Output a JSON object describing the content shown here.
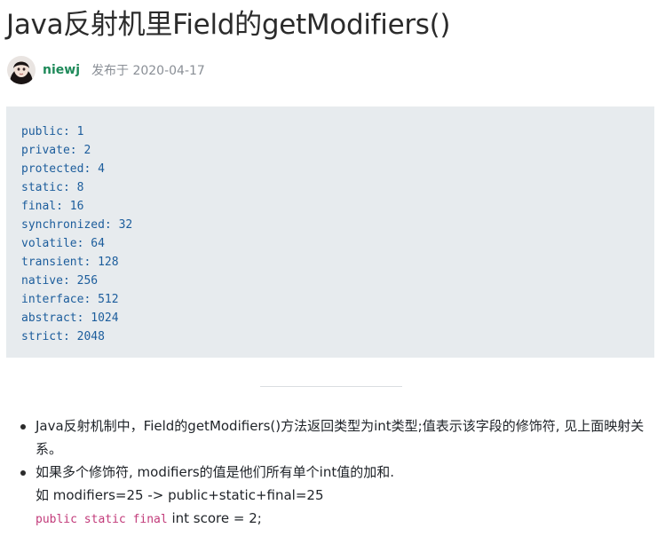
{
  "article": {
    "title": "Java反射机里Field的getModifiers()",
    "author": "niewj",
    "published": "发布于 2020-04-17"
  },
  "code_block": {
    "lines": [
      "public: 1",
      "private: 2",
      "protected: 4",
      "static: 8",
      "final: 16",
      "synchronized: 32",
      "volatile: 64",
      "transient: 128",
      "native: 256",
      "interface: 512",
      "abstract: 1024",
      "strict: 2048"
    ]
  },
  "notes": {
    "item1": "Java反射机制中，Field的getModifiers()方法返回类型为int类型;值表示该字段的修饰符, 见上面映射关系。",
    "item2_line1": "如果多个修饰符, modifiers的值是他们所有单个int值的加和.",
    "item2_line2": "如 modifiers=25 -> public+static+final=25",
    "item2_code_keywords": "public static final",
    "item2_code_rest": " int score = 2;"
  },
  "colors": {
    "author": "#1f8a5a",
    "code_text": "#1c5d9c",
    "code_background": "#e7ebee",
    "inline_keyword": "#c23b7a"
  }
}
